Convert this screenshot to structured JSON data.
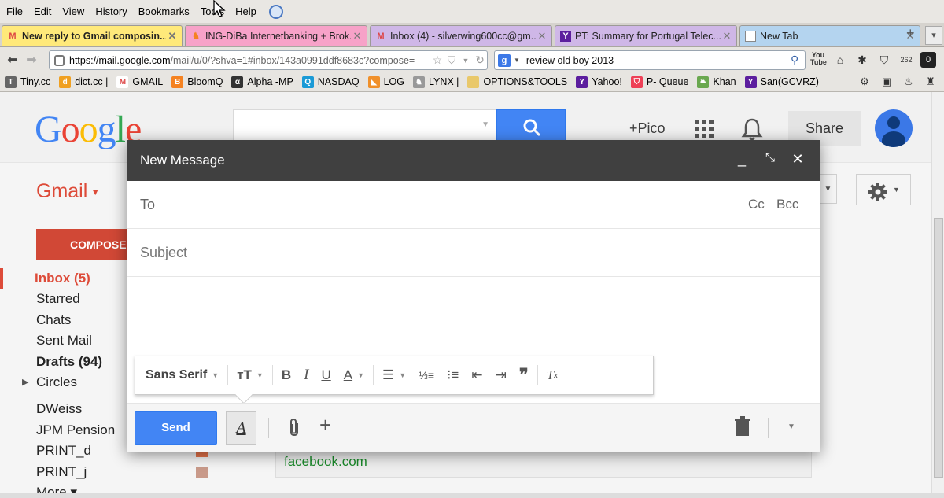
{
  "menu": [
    "File",
    "Edit",
    "View",
    "History",
    "Bookmarks",
    "Tools",
    "Help"
  ],
  "tabs": [
    {
      "label": "New reply to Gmail composin...",
      "icon": "gmail-icon"
    },
    {
      "label": "ING-DiBa Internetbanking + Brok...",
      "icon": "ing-lion-icon"
    },
    {
      "label": "Inbox (4) - silverwing600cc@gm...",
      "icon": "gmail-icon"
    },
    {
      "label": "PT: Summary for Portugal Telec...",
      "icon": "yahoo-icon"
    },
    {
      "label": "New Tab",
      "icon": "blank-page-icon"
    }
  ],
  "nav": {
    "url_host": "https://mail.google.com",
    "url_rest": "/mail/u/0/?shva=1#inbox/143a0991ddf8683c?compose=",
    "search_text": "review old boy 2013",
    "badge_262": "262",
    "badge_0": "0"
  },
  "bookmarks": [
    {
      "label": "Tiny.cc",
      "icon": "tinycc-icon",
      "color": "#555"
    },
    {
      "label": "dict.cc |",
      "icon": "dict-icon",
      "color": "#f0a020"
    },
    {
      "label": "GMAIL",
      "icon": "gmail-icon",
      "color": "#d44"
    },
    {
      "label": "BloomQ",
      "icon": "bloomberg-icon",
      "color": "#f58220"
    },
    {
      "label": "Alpha -MP",
      "icon": "alpha-icon",
      "color": "#333"
    },
    {
      "label": "NASDAQ",
      "icon": "nasdaq-icon",
      "color": "#1a9ad6"
    },
    {
      "label": "LOG",
      "icon": "log-icon",
      "color": "#f0902a"
    },
    {
      "label": "LYNX |",
      "icon": "lynx-icon",
      "color": "#777"
    },
    {
      "label": "OPTIONS&TOOLS",
      "icon": "folder-icon",
      "color": "#e9c86a"
    },
    {
      "label": "Yahoo!",
      "icon": "yahoo-icon",
      "color": "#5c1e9e"
    },
    {
      "label": "P- Queue",
      "icon": "pocket-icon",
      "color": "#ee4056"
    },
    {
      "label": "Khan",
      "icon": "leaf-icon",
      "color": "#6aa84f"
    },
    {
      "label": "San(GCVRZ)",
      "icon": "yahoo-icon",
      "color": "#5c1e9e"
    }
  ],
  "gmail": {
    "logo": "Google",
    "pico": "+Pico",
    "share": "Share",
    "label": "Gmail",
    "compose": "COMPOSE",
    "nav_items": [
      {
        "label": "Inbox (5)",
        "style": "inbox"
      },
      {
        "label": "Starred",
        "style": "normal"
      },
      {
        "label": "Chats",
        "style": "normal"
      },
      {
        "label": "Sent Mail",
        "style": "normal"
      },
      {
        "label": "Drafts (94)",
        "style": "bold"
      },
      {
        "label": "Circles",
        "style": "normal"
      }
    ],
    "labels": [
      {
        "label": "DWeiss"
      },
      {
        "label": "JPM Pension"
      },
      {
        "label": "PRINT_d",
        "color": "#e8744a"
      },
      {
        "label": "PRINT_j",
        "color": "#c99a8a"
      },
      {
        "label": "More ▾"
      }
    ],
    "bg_link": "facebook.com"
  },
  "compose": {
    "title": "New Message",
    "to_label": "To",
    "cc": "Cc",
    "bcc": "Bcc",
    "subject_placeholder": "Subject",
    "font": "Sans Serif",
    "send": "Send",
    "formatting_glyph": "A"
  },
  "colors": {
    "gmail_red": "#dd4b39",
    "send_blue": "#4285f4",
    "titlebar": "#404040",
    "active_tab": "#ffe97a"
  }
}
